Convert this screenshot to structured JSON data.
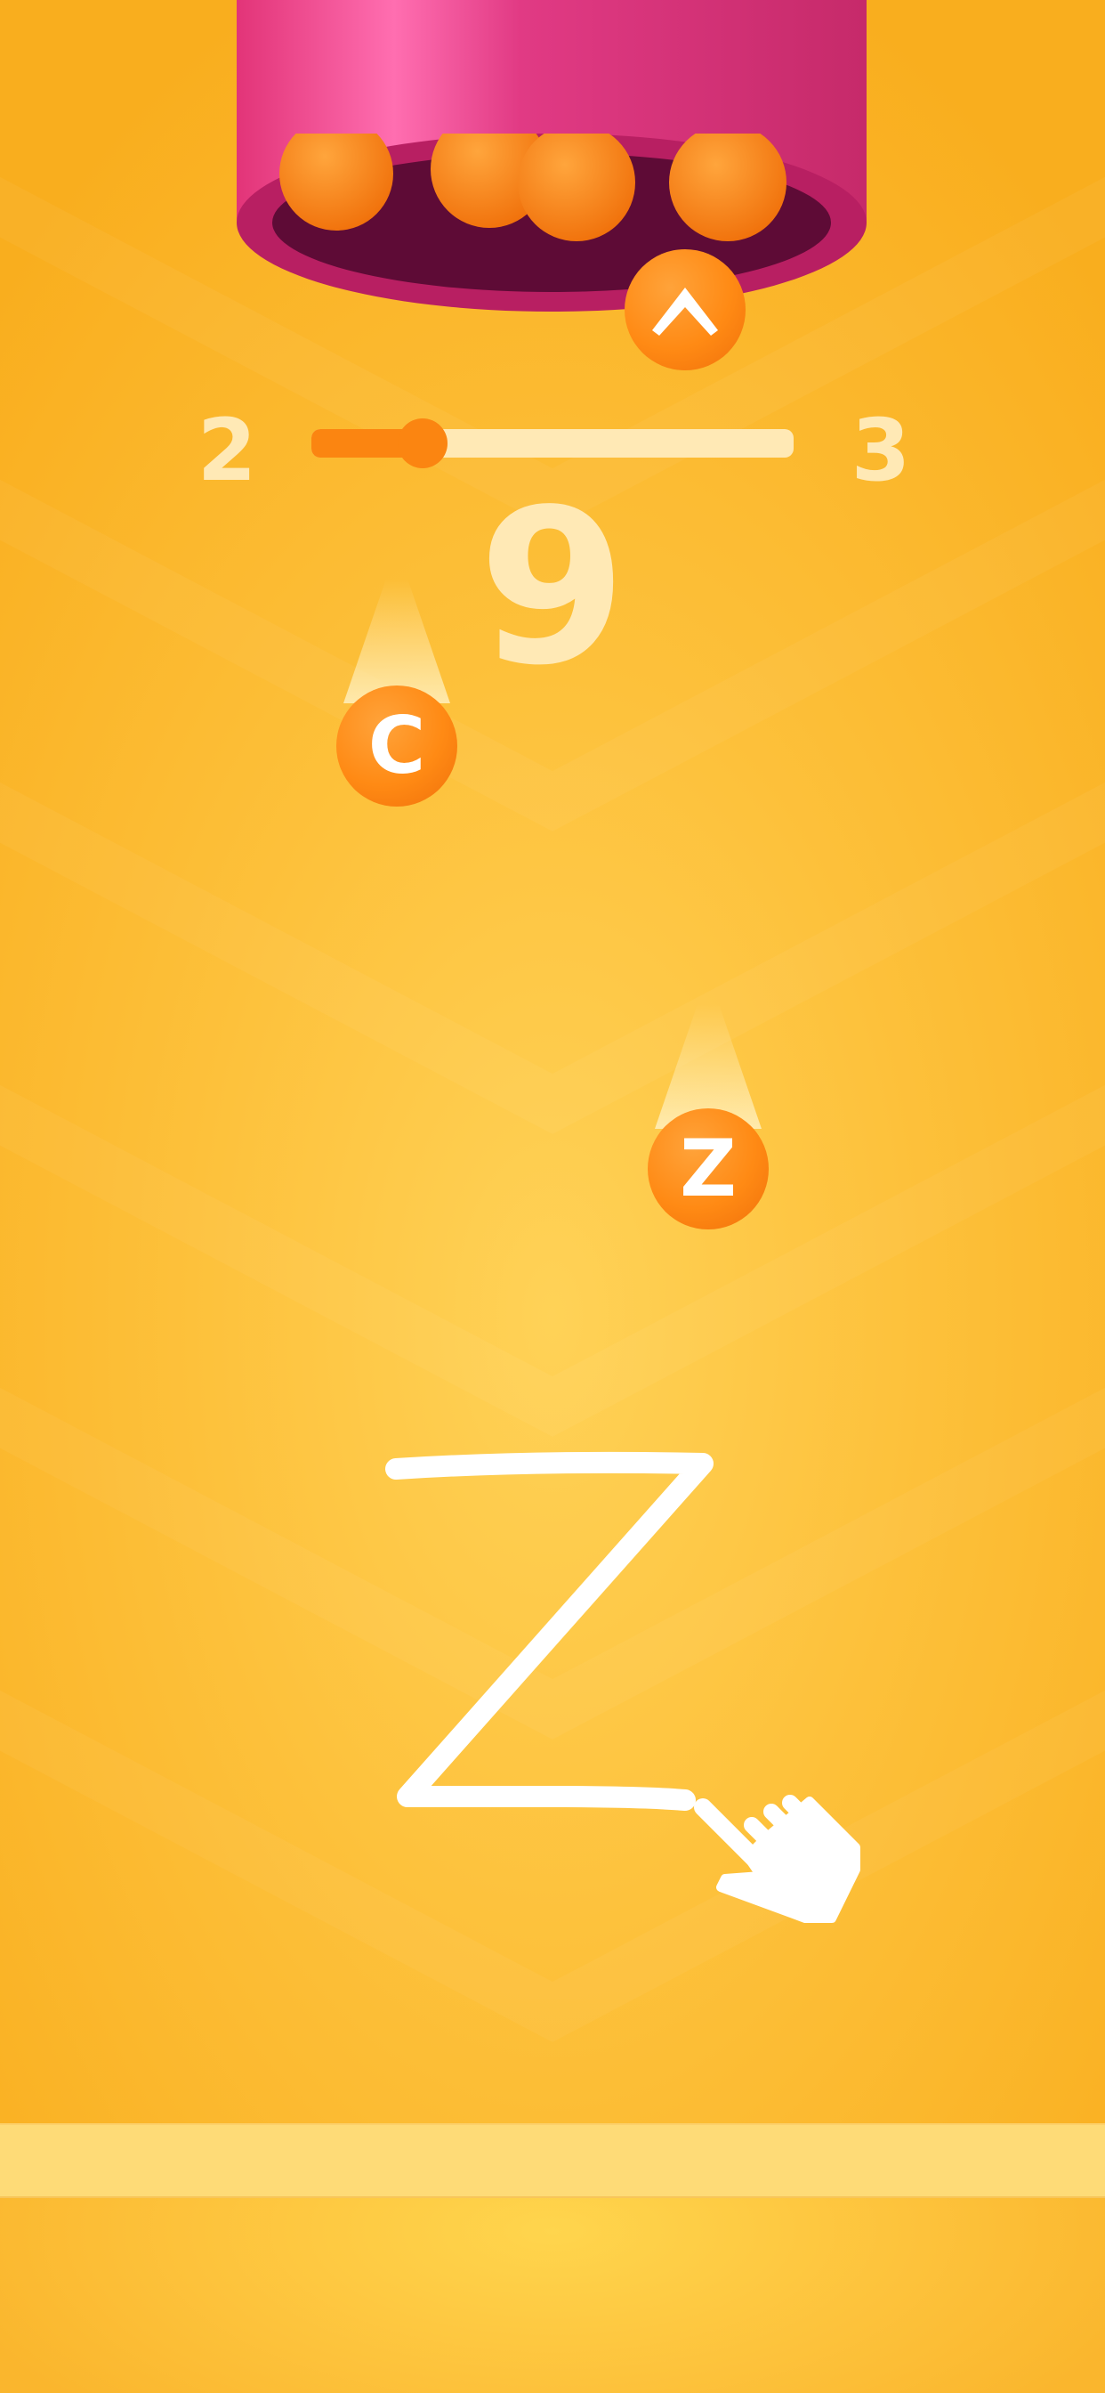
{
  "game": {
    "current_level": "2",
    "next_level": "3",
    "score": "9",
    "level_progress": 0.23
  },
  "balls": {
    "dropper_ball_glyph": "^",
    "ball_1_glyph": "C",
    "ball_2_glyph": "Z"
  },
  "tutorial": {
    "gesture_letter": "Z",
    "hand_icon": "pointing-hand-icon"
  },
  "colors": {
    "background": "#fdc13b",
    "tube": "#e3367c",
    "tube_inner": "#5e0b36",
    "ball": "#ff8a14",
    "accent_light": "#ffe9b5"
  }
}
